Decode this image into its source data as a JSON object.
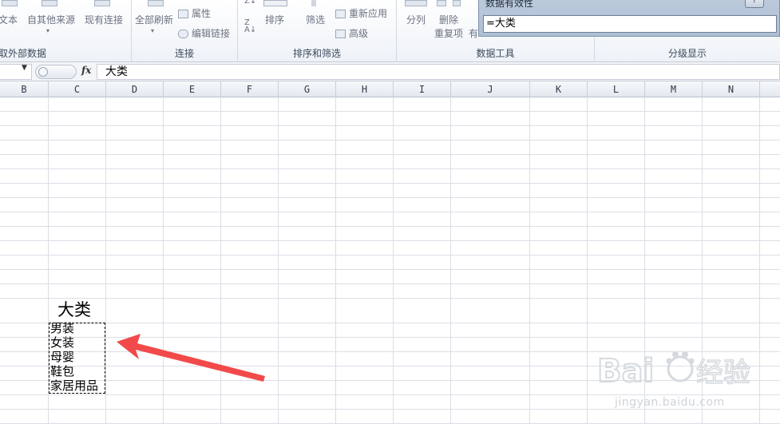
{
  "ribbon": {
    "groups": [
      {
        "label": "获取外部数据",
        "display_label": "取外部数据"
      },
      {
        "label": "连接"
      },
      {
        "label": "排序和筛选"
      },
      {
        "label": "数据工具"
      },
      {
        "label": "分级显示"
      }
    ],
    "buttons": {
      "from_text": "自文本",
      "from_text_visible": "文本",
      "from_other": "自其他来源",
      "existing_conn": "现有连接",
      "refresh_all": "全部刷新",
      "properties": "属性",
      "edit_links": "编辑链接",
      "sort": "排序",
      "filter": "筛选",
      "reapply": "重新应用",
      "advanced": "高级",
      "split": "分列",
      "remove": "删除",
      "remove_dup": "重复项",
      "valid_partial": "有"
    }
  },
  "formula_bar": {
    "fx_label": "fx",
    "content": "大类"
  },
  "columns": [
    "B",
    "C",
    "D",
    "E",
    "F",
    "G",
    "H",
    "I",
    "J",
    "K",
    "L",
    "M",
    "N"
  ],
  "cells": {
    "header": "大类",
    "items": [
      "男装",
      "女装",
      "母婴",
      "鞋包",
      "家居用品"
    ]
  },
  "dialog": {
    "title": "数据有效性",
    "help": "?",
    "input_value": "=大类"
  },
  "annotation": {
    "arrow_color": "#f24a4a"
  },
  "watermark": {
    "brand": "Baidu经验",
    "domain": "jingyan.baidu.com"
  }
}
